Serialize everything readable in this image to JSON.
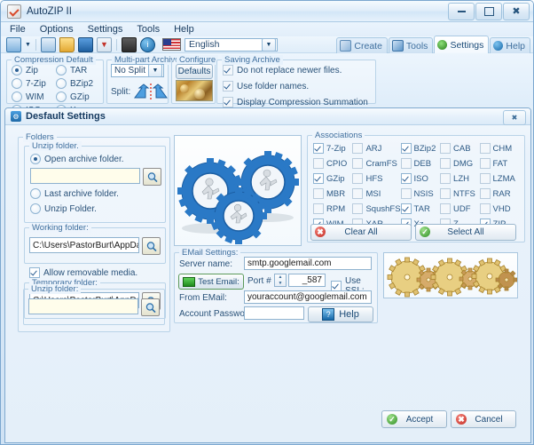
{
  "window": {
    "title": "AutoZIP II",
    "icon": "app-checkmark-icon",
    "minimize": "minimize-icon",
    "maximize": "maximize-icon",
    "close": "close-icon"
  },
  "menubar": {
    "items": [
      "File",
      "Options",
      "Settings",
      "Tools",
      "Help"
    ]
  },
  "toolbar": {
    "icons": [
      "new-archive-icon",
      "dropdown-arrow-icon",
      "extract-icon",
      "open-folder-icon",
      "save-icon",
      "filter-icon",
      "disk-icon",
      "info-icon"
    ],
    "flag": "us-flag-icon",
    "language": "English",
    "tabs": [
      {
        "label": "Create",
        "icon": "create-icon",
        "active": false
      },
      {
        "label": "Tools",
        "icon": "tools-icon",
        "active": false
      },
      {
        "label": "Settings",
        "icon": "gear-icon",
        "active": true
      },
      {
        "label": "Help",
        "icon": "help-icon",
        "active": false
      }
    ]
  },
  "options_strip": {
    "compression": {
      "title": "Compression Default",
      "col1": [
        {
          "label": "Zip",
          "selected": true
        },
        {
          "label": "7-Zip",
          "selected": false
        },
        {
          "label": "WIM",
          "selected": false
        },
        {
          "label": "ISO",
          "selected": false
        }
      ],
      "col2": [
        {
          "label": "TAR",
          "selected": false
        },
        {
          "label": "BZip2",
          "selected": false
        },
        {
          "label": "GZip",
          "selected": false
        },
        {
          "label": "Xz",
          "selected": false
        }
      ]
    },
    "multipart": {
      "title": "Multi-part Archives",
      "value": "No Split",
      "split_label": "Split:",
      "split_icon": "split-arrows-icon"
    },
    "configure": {
      "title": "Configure",
      "defaults_label": "Defaults",
      "thumb": "configure-thumbnail"
    },
    "saving": {
      "title": "Saving Archive",
      "items": [
        {
          "label": "Do not replace newer files.",
          "checked": true
        },
        {
          "label": "Use folder names.",
          "checked": true
        },
        {
          "label": "Display Compression Summation",
          "checked": true
        }
      ]
    }
  },
  "dialog": {
    "title": "Desfault Settings",
    "icon": "settings-gear-icon",
    "close": "close-icon",
    "folders": {
      "title": "Folders",
      "unzip_group_title": "Unzip folder.",
      "options": [
        {
          "label": "Open archive folder.",
          "selected": true
        },
        {
          "label": "Last archive folder.",
          "selected": false
        },
        {
          "label": "Unzip Folder.",
          "selected": false
        }
      ],
      "open_archive_value": "",
      "working_title": "Working folder:",
      "working_value": "C:\\Users\\PastorBurt\\AppData\\Local\\Au",
      "allow_removable": {
        "label": "Allow removable media.",
        "checked": true
      },
      "temp_title": "Temporary folder:",
      "temp_value": "C:\\Users\\PastorBurt\\AppData\\Local\\Au",
      "unzip_title": "Unzip folder:",
      "unzip_value": "",
      "browse_icon": "browse-folder-icon"
    },
    "gears_image": "blue-gears-running-figures-image",
    "gold_gears_image": "gold-gears-image",
    "associations": {
      "title": "Associations",
      "items": [
        {
          "label": "7-Zip",
          "checked": true
        },
        {
          "label": "ARJ",
          "checked": false
        },
        {
          "label": "BZip2",
          "checked": true
        },
        {
          "label": "CAB",
          "checked": false
        },
        {
          "label": "CHM",
          "checked": false
        },
        {
          "label": "CPIO",
          "checked": false
        },
        {
          "label": "CramFS",
          "checked": false
        },
        {
          "label": "DEB",
          "checked": false
        },
        {
          "label": "DMG",
          "checked": false
        },
        {
          "label": "FAT",
          "checked": false
        },
        {
          "label": "GZip",
          "checked": true
        },
        {
          "label": "HFS",
          "checked": false
        },
        {
          "label": "ISO",
          "checked": true
        },
        {
          "label": "LZH",
          "checked": false
        },
        {
          "label": "LZMA",
          "checked": false
        },
        {
          "label": "MBR",
          "checked": false
        },
        {
          "label": "MSI",
          "checked": false
        },
        {
          "label": "NSIS",
          "checked": false
        },
        {
          "label": "NTFS",
          "checked": false
        },
        {
          "label": "RAR",
          "checked": false
        },
        {
          "label": "RPM",
          "checked": false
        },
        {
          "label": "SqushFS",
          "checked": false
        },
        {
          "label": "TAR",
          "checked": true
        },
        {
          "label": "UDF",
          "checked": false
        },
        {
          "label": "VHD",
          "checked": false
        },
        {
          "label": "WIM",
          "checked": true
        },
        {
          "label": "XAR",
          "checked": false
        },
        {
          "label": "Xz",
          "checked": true
        },
        {
          "label": "Z",
          "checked": false
        },
        {
          "label": "ZIP",
          "checked": true
        }
      ],
      "clear_all": "Clear All",
      "select_all": "Select All"
    },
    "email": {
      "title": "EMail Settings:",
      "server_label": "Server name:",
      "server_value": "smtp.googlemail.com",
      "test_button": "Test Email:",
      "test_icon": "envelope-icon",
      "port_label": "Port #",
      "port_value": "_587",
      "use_ssl": {
        "label": "Use SSL:",
        "checked": true
      },
      "from_label": "From EMail:",
      "from_value": "youraccount@googlemail.com",
      "password_label": "Account Password:",
      "password_value": "",
      "help_button": "Help",
      "help_icon": "question-icon"
    },
    "accept_label": "Accept",
    "cancel_label": "Cancel"
  },
  "colors": {
    "accent": "#2d5f93",
    "field": "#fffdeb",
    "chrome": "#dceaf7",
    "green": "#2f8f24",
    "red": "#c32b22"
  }
}
